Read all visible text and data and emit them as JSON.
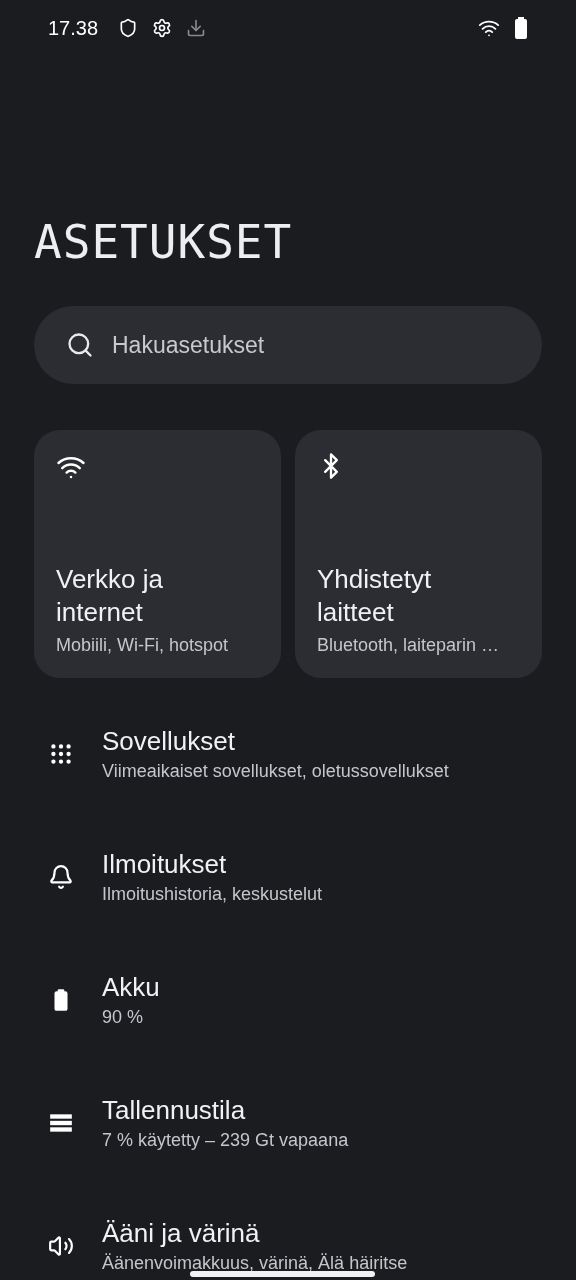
{
  "status_bar": {
    "time": "17.38"
  },
  "title": "ASETUKSET",
  "search": {
    "placeholder": "Hakuasetukset"
  },
  "cards": [
    {
      "title": "Verkko ja internet",
      "subtitle": "Mobiili, Wi-Fi, hotspot"
    },
    {
      "title": "Yhdistetyt laitteet",
      "subtitle": "Bluetooth, laiteparin …"
    }
  ],
  "items": [
    {
      "title": "Sovellukset",
      "subtitle": "Viimeaikaiset sovellukset, oletussovellukset"
    },
    {
      "title": "Ilmoitukset",
      "subtitle": "Ilmoitushistoria, keskustelut"
    },
    {
      "title": "Akku",
      "subtitle": "90 %"
    },
    {
      "title": "Tallennustila",
      "subtitle": "7 % käytetty – 239 Gt vapaana"
    },
    {
      "title": "Ääni ja värinä",
      "subtitle": "Äänenvoimakkuus, värinä, Älä häiritse"
    }
  ]
}
